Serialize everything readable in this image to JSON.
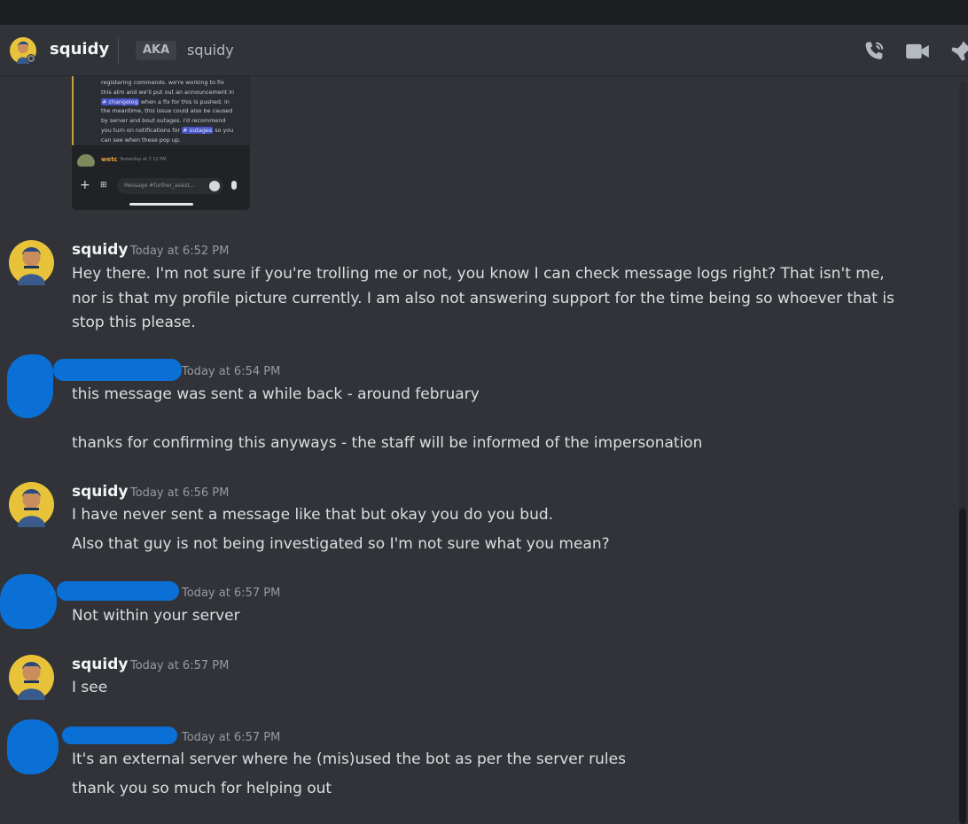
{
  "header": {
    "username": "squidy",
    "aka_label": "AKA",
    "aka_name": "squidy",
    "icons": [
      "phone-call-icon",
      "video-call-icon",
      "pin-icon"
    ]
  },
  "embed": {
    "quote_lines": [
      "registering commands. we're working to fix",
      "this atm and we'll put out an announcement in",
      "when a fix for this is pushed. in",
      "the meantime, this issue could also be caused",
      "by server and bout outages. i'd recommend",
      "you turn on notifications for",
      "so you",
      "can see when these pop up."
    ],
    "mention_changelog": "# changelog",
    "mention_outages": "# outages",
    "reply_name": "wetc",
    "reply_time": "Yesterday at 7:12 PM",
    "input_placeholder": "Message #further_assist..."
  },
  "messages": [
    {
      "author": "squidy",
      "time": "Today at 6:52 PM",
      "lines": [
        "Hey there. I'm not sure if you're trolling me or not, you know I can check message logs right? That isn't me, nor is that my profile picture currently. I am also not answering support for the time being so whoever that is stop this please."
      ]
    },
    {
      "author": "",
      "time": "Today at 6:54 PM",
      "lines": [
        "this message was sent a while back - around february",
        "thanks for confirming this anyways - the staff will be informed of the impersonation"
      ]
    },
    {
      "author": "squidy",
      "time": "Today at 6:56 PM",
      "lines": [
        "I have never sent a message like that but okay you do you bud.",
        "Also that guy is not being investigated so I'm not sure what you mean?"
      ]
    },
    {
      "author": "",
      "time": "Today at 6:57 PM",
      "lines": [
        "Not within your server"
      ]
    },
    {
      "author": "squidy",
      "time": "Today at 6:57 PM",
      "lines": [
        "I see"
      ]
    },
    {
      "author": "",
      "time": "Today at 6:57 PM",
      "lines": [
        "It's an external server where he (mis)used the bot as per the server rules",
        "thank you so much for helping out"
      ]
    }
  ],
  "colors": {
    "background": "#313338",
    "redaction": "#0a70d6",
    "mention": "#4752c4",
    "reply_name": "#e3a43d"
  }
}
